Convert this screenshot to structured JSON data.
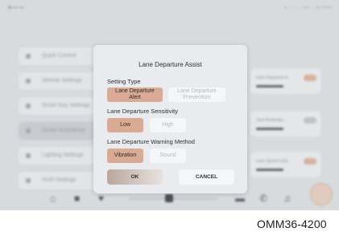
{
  "status_bar": {
    "left_text": "■ ▪▪▪ ▪▪▪",
    "right_text": "▪  ◦ ◦ ◦  ▪▪  ◦  ▪▪  ▪▪▪▪"
  },
  "background_menu": {
    "items": [
      {
        "label": "Quick Control",
        "active": false
      },
      {
        "label": "Vehicle Settings",
        "active": false
      },
      {
        "label": "Smart Key Settings",
        "active": false
      },
      {
        "label": "Driver Assistance",
        "active": true
      },
      {
        "label": "Lighting Settings",
        "active": false
      },
      {
        "label": "HUD Settings",
        "active": false
      }
    ]
  },
  "background_cards": [
    {
      "label": "Lane Departure A...",
      "toggle_on": true
    },
    {
      "label": "Start Reminder...",
      "toggle_on": false
    },
    {
      "label": "Lane Speed Limit...",
      "toggle_on": true
    }
  ],
  "dialog": {
    "title": "Lane Departure Assist",
    "setting_type": {
      "label": "Setting Type",
      "options": [
        "Lane Departure\nAlert",
        "Lane Departure\nPrevention"
      ],
      "selected": 0
    },
    "sensitivity": {
      "label": "Lane Departure Sensitivity",
      "options": [
        "Low",
        "High"
      ],
      "selected": 0
    },
    "warning_method": {
      "label": "Lane Departure Warning Method",
      "options": [
        "Vibration",
        "Sound"
      ],
      "selected": 0
    },
    "ok_label": "OK",
    "cancel_label": "CANCEL"
  },
  "caption": "OMM36-4200",
  "icons": [
    "home-icon",
    "grid-icon",
    "heart-icon",
    "play-icon",
    "car-icon",
    "phone-icon",
    "music-icon"
  ]
}
